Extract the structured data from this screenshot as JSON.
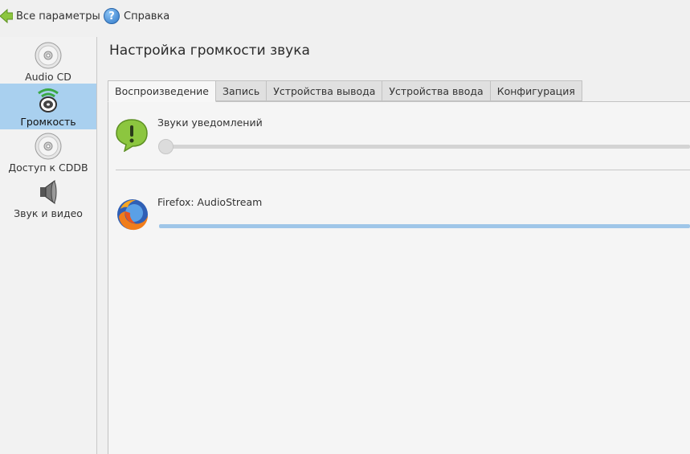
{
  "toolbar": {
    "back_label": "Все параметры",
    "help_label": "Справка",
    "help_icon_glyph": "?"
  },
  "sidebar": {
    "items": [
      {
        "label": "Audio CD",
        "icon": "cd-icon",
        "active": false
      },
      {
        "label": "Громкость",
        "icon": "volume-icon",
        "active": true
      },
      {
        "label": "Доступ к CDDB",
        "icon": "cd-icon",
        "active": false
      },
      {
        "label": "Звук и видео",
        "icon": "speaker-icon",
        "active": false
      }
    ]
  },
  "main": {
    "title": "Настройка громкости звука",
    "tabs": [
      {
        "label": "Воспроизведение",
        "active": true
      },
      {
        "label": "Запись",
        "active": false
      },
      {
        "label": "Устройства вывода",
        "active": false
      },
      {
        "label": "Устройства ввода",
        "active": false
      },
      {
        "label": "Конфигурация",
        "active": false
      }
    ],
    "streams": [
      {
        "label": "Звуки уведомлений",
        "icon": "notification-icon",
        "level": 0
      },
      {
        "label": "Firefox: AudioStream",
        "icon": "firefox-icon",
        "level": 1
      }
    ]
  },
  "colors": {
    "active_sidebar": "#a9d0ef",
    "slider_fill": "#9fc6e8"
  }
}
